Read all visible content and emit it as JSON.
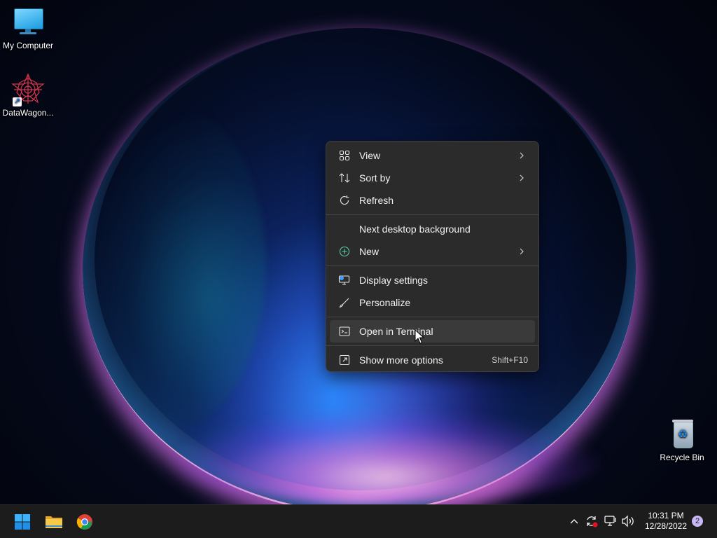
{
  "desktop": {
    "icons": [
      {
        "label": "My Computer",
        "icon": "monitor-icon"
      },
      {
        "label": "DataWagon...",
        "icon": "datawagon-app-icon"
      },
      {
        "label": "Recycle Bin",
        "icon": "recycle-bin-icon"
      }
    ]
  },
  "context_menu": {
    "items": [
      {
        "label": "View",
        "icon": "view-grid-icon",
        "submenu": true
      },
      {
        "label": "Sort by",
        "icon": "sort-icon",
        "submenu": true
      },
      {
        "label": "Refresh",
        "icon": "refresh-icon",
        "submenu": false
      },
      {
        "label": "Next desktop background",
        "icon": "",
        "submenu": false
      },
      {
        "label": "New",
        "icon": "new-plus-icon",
        "submenu": true
      },
      {
        "label": "Display settings",
        "icon": "display-settings-icon",
        "submenu": false
      },
      {
        "label": "Personalize",
        "icon": "brush-icon",
        "submenu": false
      },
      {
        "label": "Open in Terminal",
        "icon": "terminal-icon",
        "submenu": false,
        "highlighted": true
      },
      {
        "label": "Show more options",
        "icon": "more-options-icon",
        "shortcut": "Shift+F10"
      }
    ]
  },
  "taskbar": {
    "apps": [
      {
        "name": "start",
        "icon": "windows-start-icon"
      },
      {
        "name": "file-explorer",
        "icon": "folder-icon"
      },
      {
        "name": "chrome",
        "icon": "chrome-icon"
      }
    ],
    "tray": {
      "time": "10:31 PM",
      "date": "12/28/2022",
      "notification_count": "2"
    }
  },
  "colors": {
    "menu_bg": "#2b2b2b",
    "menu_hover": "#3a3a3a",
    "taskbar_bg": "#1c1c1c",
    "accent": "#0078d4"
  }
}
